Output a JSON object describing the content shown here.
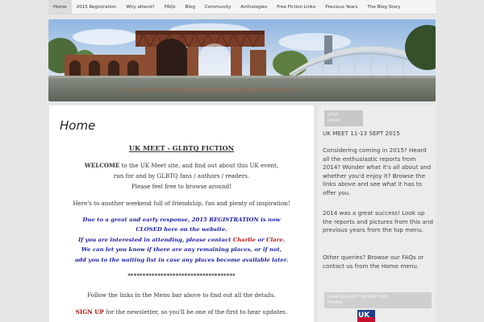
{
  "nav": {
    "items": [
      {
        "label": "Home",
        "name": "nav-item-home"
      },
      {
        "label": "2015 Registration",
        "name": "nav-item-2015-registration"
      },
      {
        "label": "Why attend?",
        "name": "nav-item-why-attend"
      },
      {
        "label": "FAQs",
        "name": "nav-item-faqs"
      },
      {
        "label": "Blog",
        "name": "nav-item-blog"
      },
      {
        "label": "Community",
        "name": "nav-item-community"
      },
      {
        "label": "Anthologies",
        "name": "nav-item-anthologies"
      },
      {
        "label": "Free Fiction Links",
        "name": "nav-item-free-fiction-links"
      },
      {
        "label": "Previous Years",
        "name": "nav-item-previous-years"
      },
      {
        "label": "The Blog Story",
        "name": "nav-item-the-blog-story"
      }
    ]
  },
  "main": {
    "page_title": "Home",
    "heading": "UK MEET - GLBTQ FICTION",
    "welcome_bold": "WELCOME",
    "welcome_rest": " to the UK Meet site, and find out about this UK event,",
    "welcome_line2": "run for and by GLBTQ fans / authors / readers.",
    "welcome_line3": "Please feel free to browse around!",
    "weekend": "Here's to another weekend full of friendship, fun and plenty of inspiration!",
    "notice_line1": "Due to a great and early response, 2015 REGISTRATION is now",
    "notice_line2": "CLOSED here on the website.",
    "notice_line3_a": "If you are interested in attending, please contact ",
    "contact_charlie": "Charlie",
    "notice_line3_or": " or ",
    "contact_clare": "Clare",
    "notice_line3_end": ".",
    "notice_line4": "We can let you know if there are any remaining places, or if not,",
    "notice_line5": "add you to the waiting list in case any places become available later.",
    "stars": "************************************",
    "follow": "Follow the links in the Menu bar above to find out all the details.",
    "signup_link": "SIGN UP",
    "signup_rest": " for the newsletter, so you'll be one of the first to hear updates."
  },
  "sidebar": {
    "stop_press_line1": "STOP",
    "stop_press_line2": "PRESS",
    "event_dates": "UK MEET 11-13 SEPT 2015",
    "para1": "Considering coming in 2015? Heard all the enthusiastic reports from 2014? Wonder what it's all about and whether you'd enjoy it? Browse the links above and see what it has to offer you.",
    "para2": "2014 was a great success! Look up the reports and pictures from this and previous years from the top menu.",
    "para3": "Other queries? Browse our FAQs or contact us from the Home menu.",
    "grab_line1": "GRAB OUR BUTTON FOR YOUR",
    "grab_line2": "PROMO",
    "logo_text": "UK"
  },
  "colors": {
    "accent_red": "#b3140f",
    "notice_blue": "#1a1aa8",
    "page_bg": "#e6e6e6"
  }
}
